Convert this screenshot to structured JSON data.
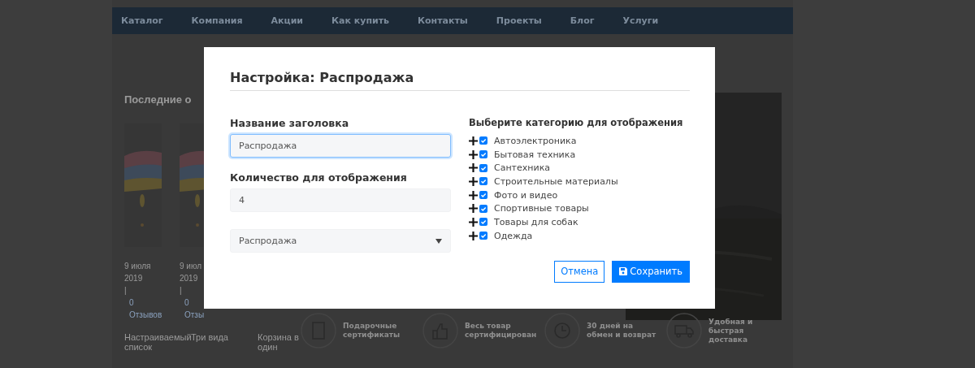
{
  "nav": {
    "items": [
      "Каталог",
      "Компания",
      "Акции",
      "Как купить",
      "Контакты",
      "Проекты",
      "Блог",
      "Услуги"
    ]
  },
  "section_title": "Последние о",
  "cards": [
    {
      "date": "9 июля",
      "year": "2019",
      "separator": "|",
      "count": "0",
      "reviews": "Отзывов",
      "title": "Настраиваемый список"
    },
    {
      "date": "9 июл",
      "year": "2019",
      "separator": "|",
      "count": "0",
      "reviews": "Отзы",
      "title": "Три вида"
    },
    {
      "title": "Корзина в один"
    }
  ],
  "features": [
    {
      "kind": "gift",
      "text": "Подарочные сертификаты"
    },
    {
      "kind": "thumb",
      "text": "Весь товар сертифицирован"
    },
    {
      "kind": "clock",
      "text": "30 дней на обмен и возврат"
    },
    {
      "kind": "truck",
      "text": "Удобная и быстрая доставка"
    }
  ],
  "modal": {
    "title": "Настройка: Распродажа",
    "fields": [
      {
        "kind": "text",
        "label": "Название заголовка",
        "value": "Распродажа",
        "focused": true
      },
      {
        "kind": "text",
        "label": "Количество для отображения",
        "value": "4",
        "focused": false
      },
      {
        "kind": "select",
        "value": "Распродажа",
        "focused": false
      }
    ],
    "categories": {
      "heading": "Выберите категорию для отображения",
      "items": [
        {
          "label": "Автоэлектроника",
          "checked": true
        },
        {
          "label": "Бытовая техника",
          "checked": true
        },
        {
          "label": "Сантехника",
          "checked": true
        },
        {
          "label": "Строительные материалы",
          "checked": true
        },
        {
          "label": "Фото и видео",
          "checked": true
        },
        {
          "label": "Спортивные товары",
          "checked": true
        },
        {
          "label": "Товары для собак",
          "checked": true
        },
        {
          "label": "Одежда",
          "checked": true
        }
      ]
    },
    "buttons": {
      "cancel": "Отмена",
      "save": "Сохранить"
    }
  }
}
